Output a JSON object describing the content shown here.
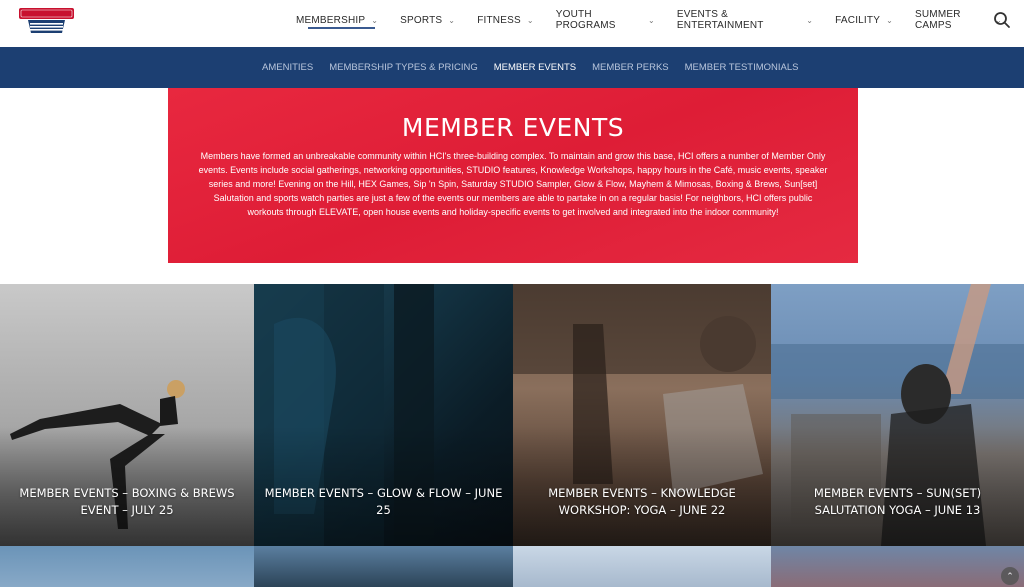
{
  "header": {
    "logo_text": "HALL OF COURTS CLUB",
    "nav": [
      {
        "label": "Membership",
        "active": true
      },
      {
        "label": "Sports"
      },
      {
        "label": "Fitness"
      },
      {
        "label": "Youth Programs"
      },
      {
        "label": "Events & Entertainment"
      },
      {
        "label": "Facility"
      },
      {
        "label": "Summer Camps"
      }
    ]
  },
  "subnav": [
    {
      "label": "Amenities"
    },
    {
      "label": "Membership Types & Pricing"
    },
    {
      "label": "Member Events",
      "active": true
    },
    {
      "label": "Member Perks"
    },
    {
      "label": "Member Testimonials"
    }
  ],
  "hero": {
    "title": "MEMBER EVENTS",
    "body": "Members have formed an unbreakable community within HCI's three-building complex. To maintain and grow this base, HCI offers a number of Member Only events. Events include social gatherings, networking opportunities, STUDIO features, Knowledge Workshops, happy hours in the Café, music events, speaker series and more! Evening on the Hill, HEX Games, Sip 'n Spin, Saturday STUDIO Sampler, Glow & Flow, Mayhem & Mimosas, Boxing & Brews, Sun[set] Salutation and sports watch parties are just a few of the events our members are able to partake in on a regular basis! For neighbors, HCI offers public workouts through ELEVATE, open house events and holiday-specific events to get involved and integrated into the indoor community!"
  },
  "tiles": [
    {
      "caption": "Member Events – Boxing & Brews Event – July 25"
    },
    {
      "caption": "Member Events – Glow & Flow – June 25"
    },
    {
      "caption": "Member Events – Knowledge Workshop: Yoga – June 22"
    },
    {
      "caption": "Member Events – Sun(set) Salutation Yoga – June 13"
    }
  ],
  "colors": {
    "subnav_bg": "#1c3f72",
    "hero_bg": "#e3203a"
  }
}
